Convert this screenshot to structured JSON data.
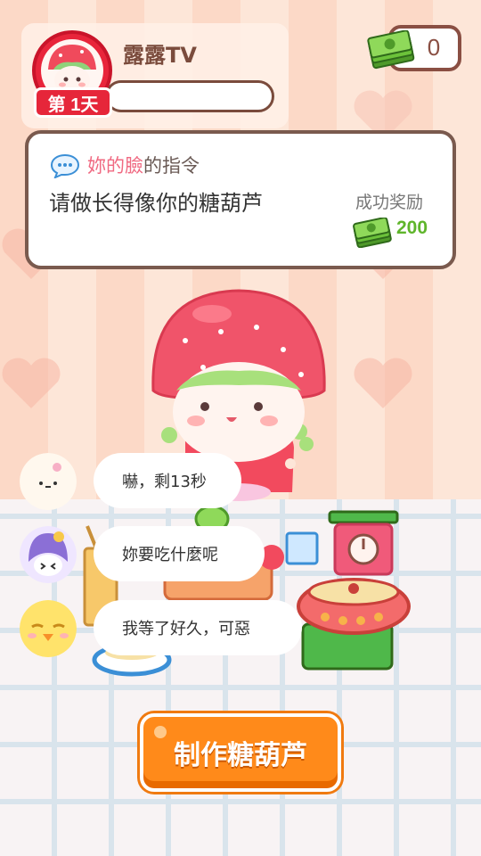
{
  "profile": {
    "channel_name": "露露TV",
    "day_label": "第 1天"
  },
  "money": {
    "value": "0"
  },
  "order": {
    "from_name": "妳的臉",
    "from_suffix": "的指令",
    "text": "请做长得像你的糖葫芦",
    "reward_label": "成功奖励",
    "reward_value": "200"
  },
  "comments": [
    {
      "text": "嚇，剩13秒",
      "avatar": "white-blob-avatar"
    },
    {
      "text": "妳要吃什麼呢",
      "avatar": "purple-girl-avatar"
    },
    {
      "text": "我等了好久，可惡",
      "avatar": "yellow-chick-avatar"
    }
  ],
  "action": {
    "make_label": "制作糖葫芦"
  },
  "colors": {
    "accent_red": "#e6263a",
    "money_green": "#5fb52b",
    "button_orange": "#ff8a1a",
    "order_name_pink": "#f06a82"
  }
}
